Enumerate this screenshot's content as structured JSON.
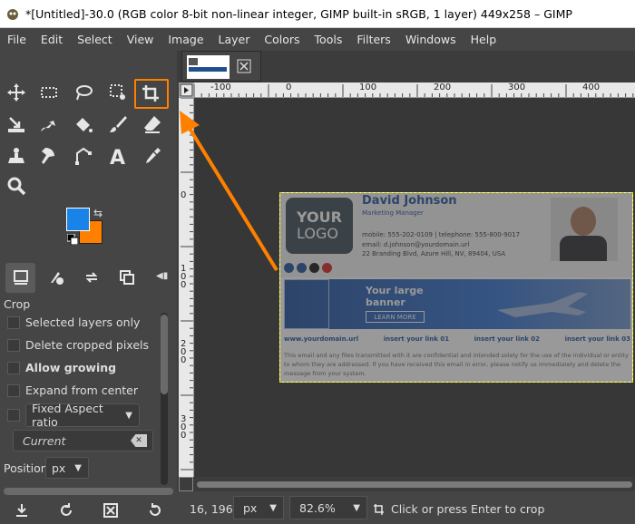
{
  "window": {
    "title": "*[Untitled]-30.0 (RGB color 8-bit non-linear integer, GIMP built-in sRGB, 1 layer) 449x258 – GIMP"
  },
  "menu": [
    "File",
    "Edit",
    "Select",
    "View",
    "Image",
    "Layer",
    "Colors",
    "Tools",
    "Filters",
    "Windows",
    "Help"
  ],
  "tool_options": {
    "title": "Crop",
    "selected_layers_only": "Selected layers only",
    "delete_cropped": "Delete cropped pixels",
    "allow_growing": "Allow growing",
    "expand_center": "Expand from center",
    "aspect": "Fixed Aspect ratio",
    "current_placeholder": "Current",
    "position_label": "Position:",
    "position_unit": "px"
  },
  "ruler_top": [
    "-100",
    "0",
    "100",
    "200",
    "300",
    "400"
  ],
  "ruler_left": [
    "0",
    "1\n0\n0",
    "2\n0\n0",
    "3\n0\n0"
  ],
  "image_content": {
    "logo_line1": "YOUR",
    "logo_line2": "LOGO",
    "name": "David Johnson",
    "role": "Marketing Manager",
    "contact": "mobile: 555-202-0109  |  telephone: 555-800-9017",
    "email": "email: d.johnson@yourdomain.url",
    "address": "22 Branding Blvd, Azure Hill, NV, 89404, USA",
    "banner_line1": "Your large",
    "banner_line2": "banner",
    "banner_button": "LEARN MORE",
    "links": [
      "www.yourdomain.url",
      "insert your link 01",
      "insert your link 02",
      "insert your link 03"
    ],
    "disclaimer": "This email and any files transmitted with it are confidential and intended solely for the use of the individual or entity to whom they are addressed. If you have received this email in error, please notify us immediately and delete the message from your system."
  },
  "status": {
    "coords": "16, 196",
    "unit": "px",
    "zoom": "82.6%",
    "message": "Click or press Enter to crop"
  },
  "colors": {
    "foreground": "#1a83e8",
    "background": "#ff7f00",
    "highlight": "#ff8000"
  }
}
